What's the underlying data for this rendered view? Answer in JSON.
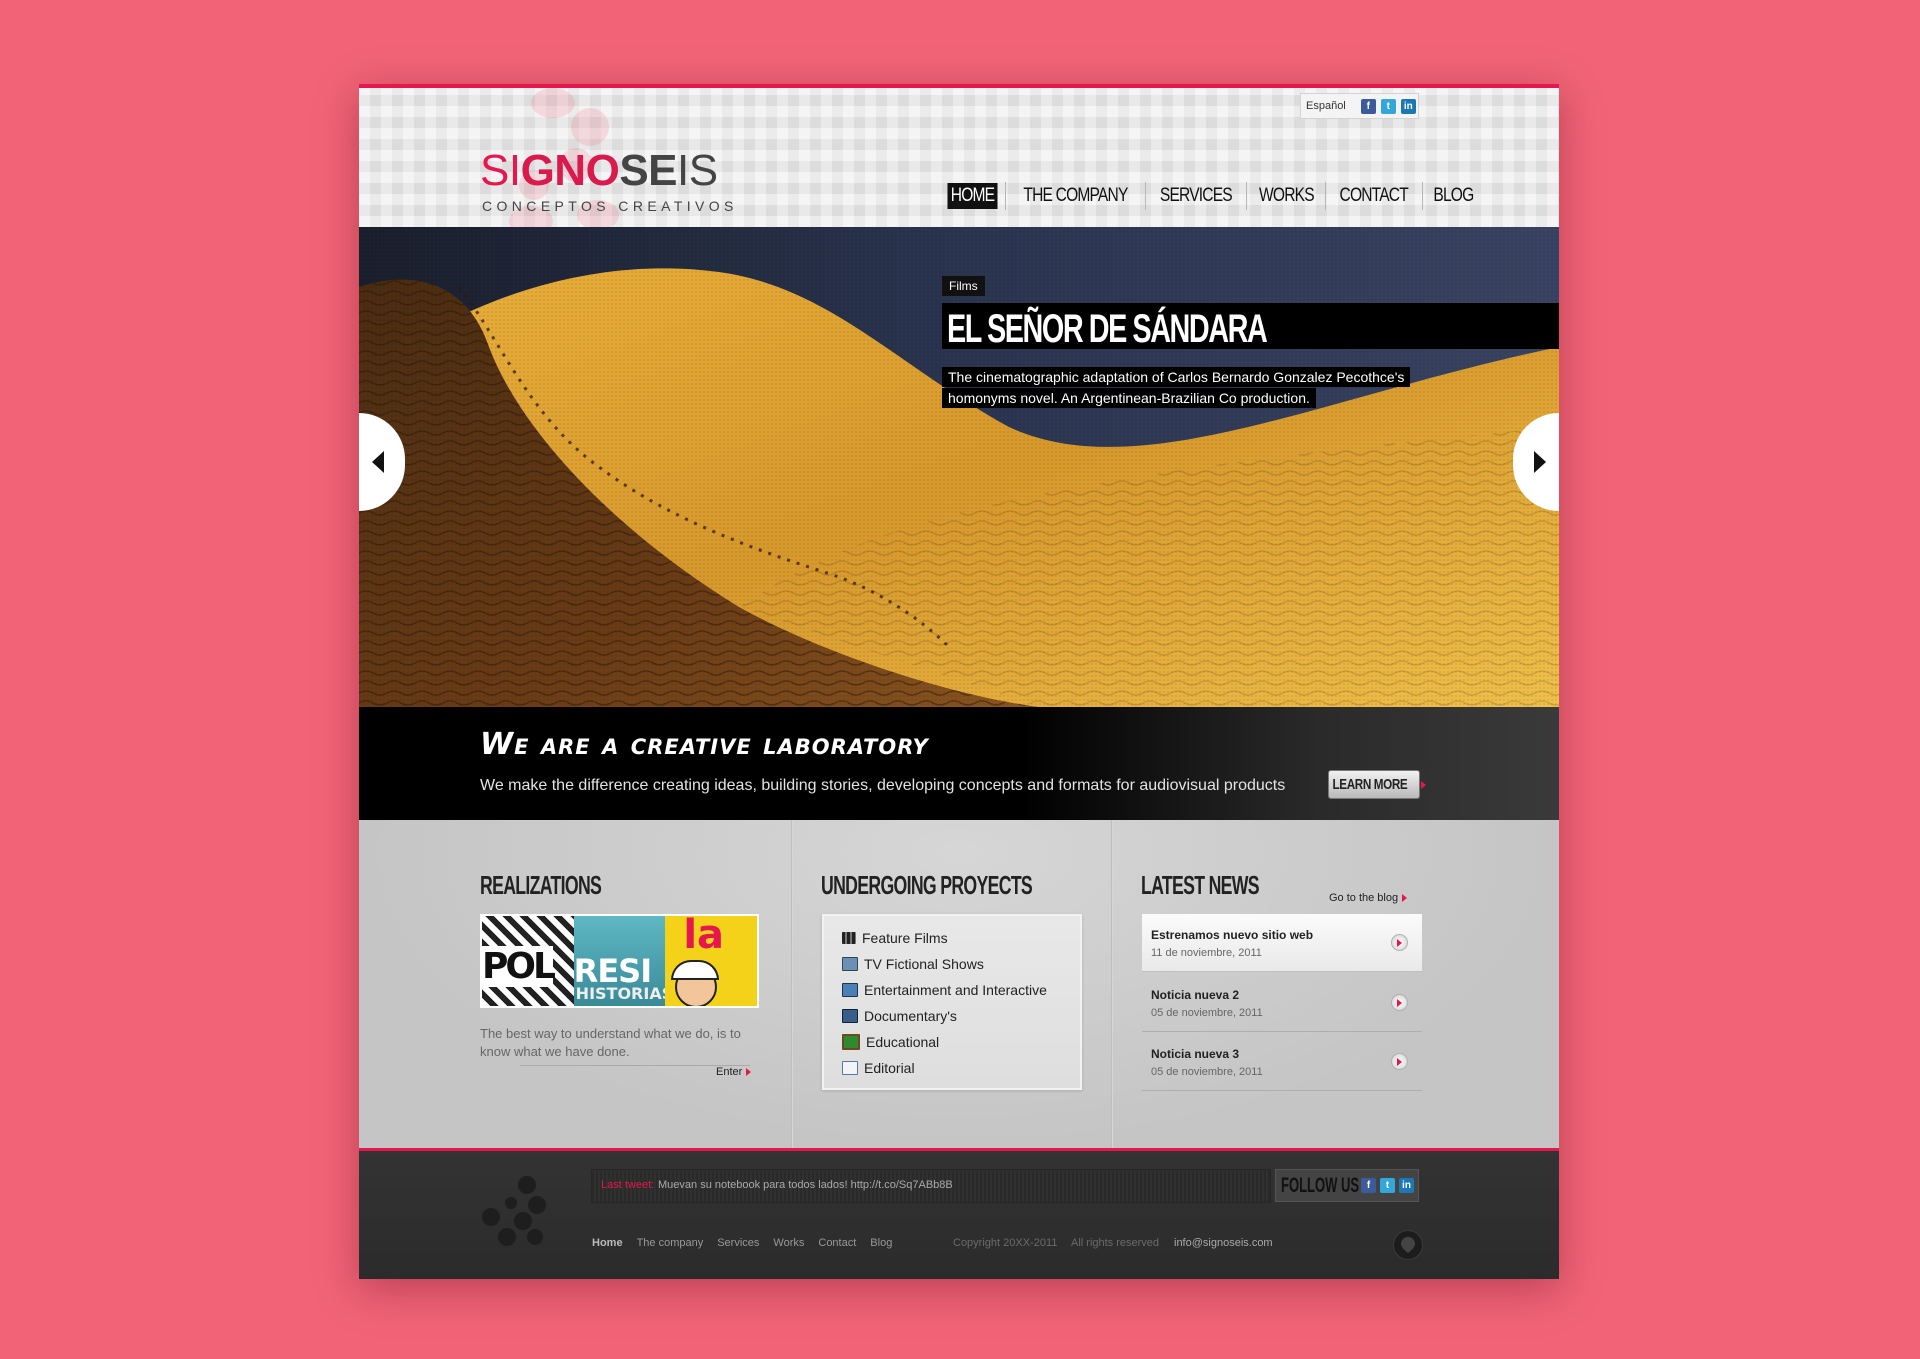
{
  "header": {
    "logo_text_1": "SI",
    "logo_text_2": "GNO",
    "logo_text_3": "SE",
    "logo_text_4": "IS",
    "logo_tagline": "CONCEPTOS CREATIVOS",
    "language": "Español",
    "social": [
      "facebook-icon",
      "twitter-icon",
      "linkedin-icon"
    ],
    "nav": [
      "HOME",
      "THE COMPANY",
      "SERVICES",
      "WORKS",
      "CONTACT",
      "BLOG"
    ],
    "active_nav": "HOME"
  },
  "hero": {
    "tag": "Films",
    "title": "EL SEÑOR DE SÁNDARA",
    "description": "The cinematographic adaptation of Carlos Bernardo Gonzalez Pecothce's homonyms novel. An Argentinean-Brazilian Co production."
  },
  "banner": {
    "title": "We are a creative laboratory",
    "text": "We make the difference creating ideas, building stories, developing concepts and formats for audiovisual products",
    "button": "LEARN MORE"
  },
  "realizations": {
    "title": "REALIZATIONS",
    "thumb_texts": [
      "POL",
      "RESI",
      "HISTORIAS",
      "la"
    ],
    "text": "The best way to understand what we do, is to know what we have done.",
    "link": "Enter"
  },
  "projects": {
    "title": "UNDERGOING PROYECTS",
    "items": [
      "Feature Films",
      "TV Fictional Shows",
      "Entertainment and Interactive",
      "Documentary's",
      "Educational",
      "Editorial"
    ]
  },
  "news": {
    "title": "LATEST NEWS",
    "link": "Go to the blog",
    "items": [
      {
        "title": "Estrenamos nuevo sitio web",
        "date": "11 de noviembre, 2011"
      },
      {
        "title": "Noticia nueva 2",
        "date": "05 de noviembre, 2011"
      },
      {
        "title": "Noticia nueva 3",
        "date": "05 de noviembre, 2011"
      }
    ]
  },
  "footer": {
    "tweet_label": "Last tweet:",
    "tweet_text": "Muevan su notebook para todos lados! http://t.co/Sq7ABb8B",
    "follow_label": "FOLLOW US",
    "nav": [
      "Home",
      "The company",
      "Services",
      "Works",
      "Contact",
      "Blog"
    ],
    "copyright": "Copyright 20XX-2011",
    "rights": "All rights reserved",
    "email": "info@signoseis.com"
  },
  "colors": {
    "background": "#f26377",
    "accent": "#e5174e",
    "footer": "#2f2f2f"
  }
}
